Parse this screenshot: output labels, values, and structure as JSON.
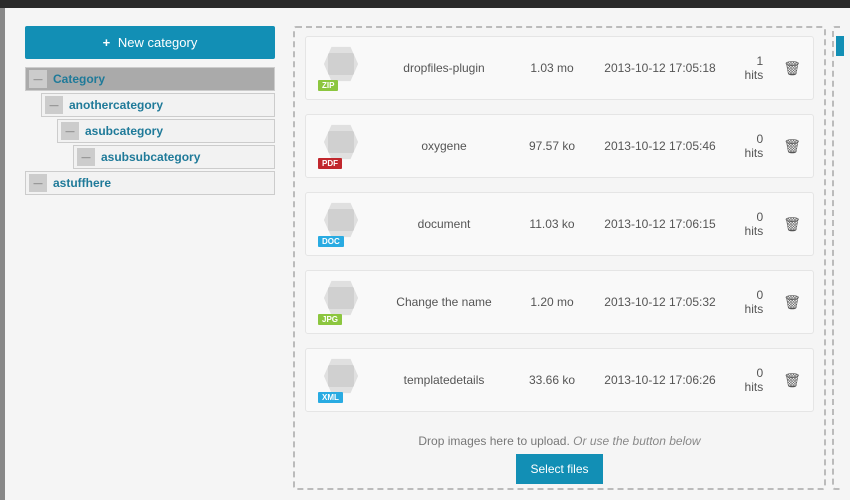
{
  "new_category_label": "New category",
  "tree": {
    "root": "Category",
    "items": [
      {
        "label": "anothercategory"
      },
      {
        "label": "asubcategory"
      },
      {
        "label": "asubsubcategory"
      }
    ],
    "sibling": "astuffhere"
  },
  "files": [
    {
      "type": "ZIP",
      "badge_class": "zip",
      "name": "dropfiles-plugin",
      "size": "1.03 mo",
      "date": "2013-10-12 17:05:18",
      "hits": "1 hits"
    },
    {
      "type": "PDF",
      "badge_class": "pdf",
      "name": "oxygene",
      "size": "97.57 ko",
      "date": "2013-10-12 17:05:46",
      "hits": "0 hits"
    },
    {
      "type": "DOC",
      "badge_class": "doc",
      "name": "document",
      "size": "11.03 ko",
      "date": "2013-10-12 17:06:15",
      "hits": "0 hits"
    },
    {
      "type": "JPG",
      "badge_class": "jpg",
      "name": "Change the name",
      "size": "1.20 mo",
      "date": "2013-10-12 17:05:32",
      "hits": "0 hits"
    },
    {
      "type": "XML",
      "badge_class": "xml",
      "name": "templatedetails",
      "size": "33.66 ko",
      "date": "2013-10-12 17:06:26",
      "hits": "0 hits"
    }
  ],
  "upload": {
    "hint_a": "Drop images here to upload.",
    "hint_b": "Or use the button below",
    "button": "Select files"
  }
}
